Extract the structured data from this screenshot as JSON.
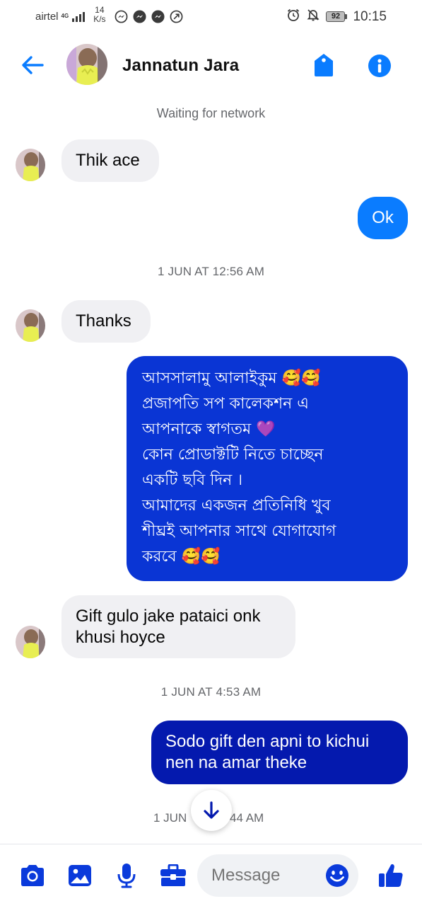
{
  "status_bar": {
    "carrier": "airtel",
    "network": "4G",
    "speed_value": "14",
    "speed_unit": "K/s",
    "battery": "92",
    "time": "10:15"
  },
  "header": {
    "contact_name": "Jannatun Jara"
  },
  "network_status": "Waiting for network",
  "messages": [
    {
      "direction": "incoming",
      "text": "Thik ace"
    },
    {
      "direction": "outgoing",
      "text": "Ok"
    },
    {
      "type": "timestamp",
      "text": "1 JUN AT 12:56 AM"
    },
    {
      "direction": "incoming",
      "text": "Thanks"
    },
    {
      "direction": "outgoing",
      "lines": [
        "আসসালামু আলাইকুম 🥰🥰",
        "প্রজাপতি  সপ কালেকশন এ",
        "আপনাকে স্বাগতম 💜",
        "কোন প্রোডাক্টটি নিতে চাচ্ছেন",
        "একটি ছবি দিন ।",
        "আমাদের একজন প্রতিনিধি খুব",
        "শীঘ্রই আপনার সাথে যোগাযোগ",
        "করবে 🥰🥰"
      ]
    },
    {
      "direction": "incoming",
      "lines": [
        "Gift gulo jake pataici onk",
        "khusi hoyce"
      ]
    },
    {
      "type": "timestamp",
      "text": "1 JUN AT 4:53 AM"
    },
    {
      "direction": "outgoing",
      "lines": [
        "Sodo gift den apni to kichui",
        "nen na amar theke"
      ]
    },
    {
      "type": "timestamp",
      "text_left": "1 JUN",
      "text_right": "44 AM"
    }
  ],
  "composer": {
    "placeholder": "Message"
  },
  "colors": {
    "accent": "#0a7cff",
    "bubble_incoming": "#f0f0f3",
    "bubble_outgoing_gradient": [
      "#0a2ee0",
      "#0634c9",
      "#0419a8"
    ]
  },
  "icons": [
    "back-arrow-icon",
    "tag-icon",
    "info-icon",
    "camera-icon",
    "image-icon",
    "microphone-icon",
    "briefcase-icon",
    "emoji-icon",
    "thumbs-up-icon",
    "arrow-down-icon"
  ]
}
